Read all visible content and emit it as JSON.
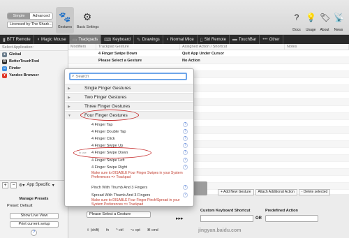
{
  "toolbar": {
    "seg_simple": "Simple",
    "seg_advanced": "Advanced",
    "license": "Licensed by The Shark...",
    "gestures_label": "Gestures",
    "basic_settings_label": "Basic Settings",
    "docs_label": "Docs",
    "usage_label": "Usage",
    "about_label": "About",
    "news_label": "News"
  },
  "tabs": [
    {
      "label": "BTT Remote",
      "icon": "remote-icon"
    },
    {
      "label": "Magic Mouse",
      "icon": "mouse-icon"
    },
    {
      "label": "Trackpads",
      "icon": "trackpad-icon"
    },
    {
      "label": "Keyboard",
      "icon": "keyboard-icon"
    },
    {
      "label": "Drawings",
      "icon": "drawing-icon"
    },
    {
      "label": "Normal Mice",
      "icon": "mouse-icon"
    },
    {
      "label": "Siri Remote",
      "icon": "remote-icon"
    },
    {
      "label": "TouchBar",
      "icon": "touchbar-icon"
    },
    {
      "label": "Other",
      "icon": "more-icon"
    }
  ],
  "left": {
    "header": "Select Application:",
    "apps": [
      {
        "name": "Global",
        "color": "#6b7d8c"
      },
      {
        "name": "BetterTouchTool",
        "color": "#333333"
      },
      {
        "name": "Finder",
        "color": "#3b8de0"
      },
      {
        "name": "Yandex Browser",
        "color": "#e0392b"
      }
    ],
    "add": "+",
    "remove": "−",
    "app_specific": "App Specific",
    "manage_presets": "Manage Presets",
    "preset": "Preset: Default",
    "show_live_view": "Show Live View",
    "print_setup": "Print current setup",
    "help": "?"
  },
  "table": {
    "headers": [
      "Modifiers",
      "Trackpad Gesture",
      "Assigned Action / Shortcut",
      "Notes"
    ],
    "rows": [
      {
        "modifiers": "",
        "gesture": "4 Finger Swipe Down",
        "action": "Quit App Under Cursor",
        "notes": ""
      },
      {
        "modifiers": "",
        "gesture": "Please Select a Gesture",
        "action": "No Action",
        "notes": ""
      }
    ]
  },
  "actions": {
    "add_gesture": "+ Add New Gesture",
    "attach_action": "Attach Additional Action",
    "delete": "- Delete selected"
  },
  "bottom": {
    "select_gesture": "Please Select a Gesture",
    "custom_shortcut": "Custom Keyboard Shortcut",
    "or": "OR",
    "predefined": "Predefined Action",
    "mods": [
      "⇧ (shift)",
      "fn",
      "^ ctrl",
      "⌥ opt",
      "⌘ cmd"
    ],
    "arrows": "▸▸▸",
    "watermark": "jingyan.baidu.com"
  },
  "popup": {
    "search_placeholder": "Search",
    "categories": [
      "Single Finger Gestures",
      "Two Finger Gestures",
      "Three Finger Gestures",
      "Four Finger Gestures"
    ],
    "items": [
      "4 Finger Tap",
      "4 Finger Double Tap",
      "4 Finger Click",
      "4 Finger Swipe Up",
      "4 Finger Swipe Down",
      "4 Finger Swipe Left",
      "4 Finger Swipe Right"
    ],
    "in_use": "in use",
    "warning1": "Make sure to DISABLE Four Finger Swipes in your System Preferences => Trackpad",
    "pinch_in": "Pinch With Thumb And 3 Fingers",
    "spread": "Spread With Thumb And 3 Fingers",
    "warning2": "Make sure to DISABLE Four Finger Pinch/Spread in your System Preferences => Trackpad"
  },
  "colors": {
    "accent": "#3b7ff0",
    "highlight_oval": "#c52a2a",
    "tabbar": "#2a2a2a"
  }
}
